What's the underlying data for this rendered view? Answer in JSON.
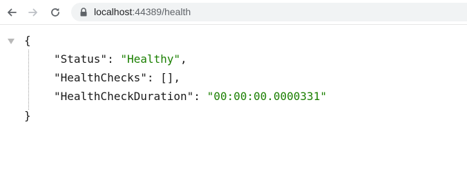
{
  "browser": {
    "url_host": "localhost",
    "url_path": ":44389/health",
    "icons": {
      "back": "arrow-left-icon",
      "forward": "arrow-right-icon",
      "reload": "reload-icon",
      "security": "lock-icon"
    }
  },
  "json_view": {
    "open_brace": "{",
    "close_brace": "}",
    "entries": [
      {
        "key": "\"Status\"",
        "sep": ": ",
        "value": "\"Healthy\"",
        "trail": ",",
        "value_type": "string"
      },
      {
        "key": "\"HealthChecks\"",
        "sep": ": ",
        "value": "[]",
        "trail": ",",
        "value_type": "array"
      },
      {
        "key": "\"HealthCheckDuration\"",
        "sep": ": ",
        "value": "\"00:00:00.0000331\"",
        "trail": "",
        "value_type": "string"
      }
    ],
    "colors": {
      "string": "#1a7f00",
      "punctuation": "#1a1a1a"
    }
  }
}
